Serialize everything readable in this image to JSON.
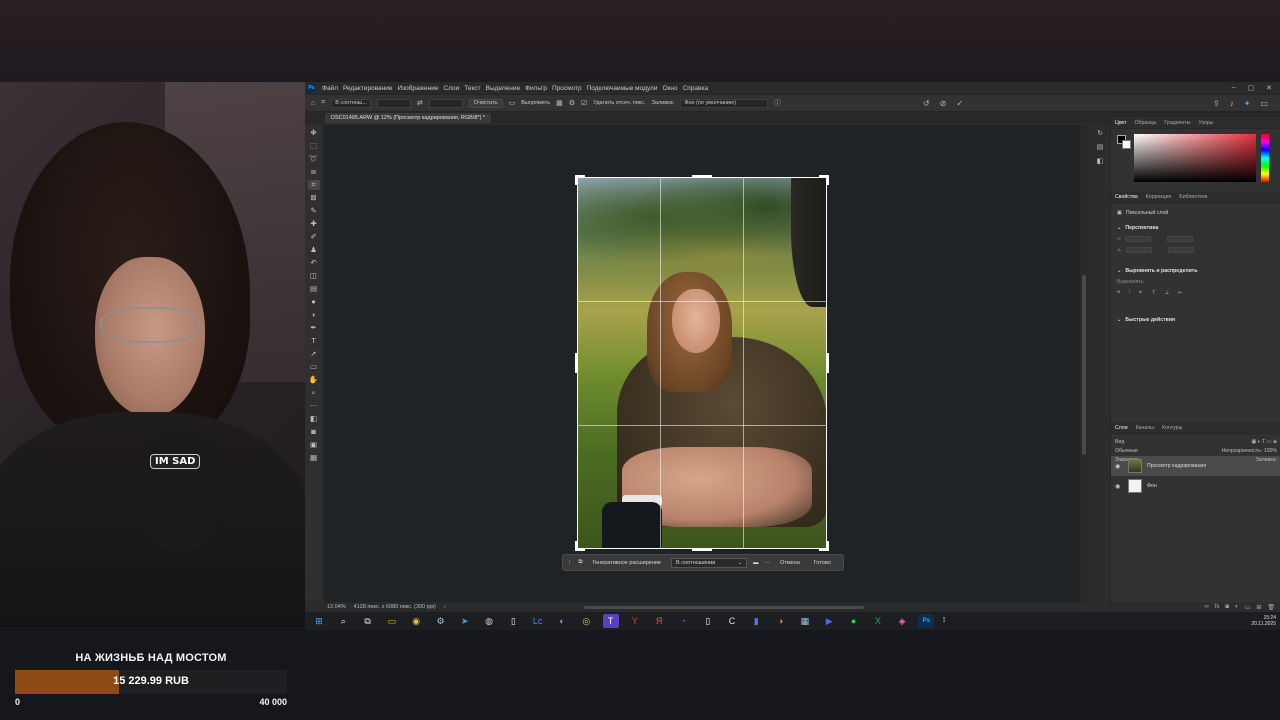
{
  "goal": {
    "title": "НА ЖИЗНЬБ НАД МОСТОМ",
    "amount": "15 229.99 RUB",
    "min": "0",
    "max": "40 000",
    "progress": 0.3807,
    "bar_color": "#8e4a14"
  },
  "webcam": {
    "mic_label": "IM SAD"
  },
  "photoshop": {
    "logo": "Ps",
    "menu": [
      "Файл",
      "Редактирование",
      "Изображение",
      "Слои",
      "Текст",
      "Выделение",
      "Фильтр",
      "Просмотр",
      "Подключаемые модули",
      "Окно",
      "Справка"
    ],
    "options": {
      "ratio": "В соотнош...",
      "clear": "Очистить",
      "straighten": "Выпрямить",
      "delete_pixels": "Удалить отсеч. пикс.",
      "fill_label": "Заливка:",
      "fill_value": "Фон (по умолчанию)"
    },
    "doc_tab": "DSC01495.ARW @ 12% (Просмотр кадрирования, RGB/8*) *",
    "crop_bar": {
      "generative": "Генеративное расширение",
      "ratio": "В соотношении",
      "cancel": "Отмена",
      "done": "Готово"
    },
    "status": {
      "zoom": "12.04%",
      "info": "4128 пикс. x 6080 пикс. (300 ppi)"
    },
    "panels": {
      "color_tabs": [
        "Цвет",
        "Образцы",
        "Градиенты",
        "Узоры"
      ],
      "props_tabs": [
        "Свойства",
        "Коррекция",
        "Библиотеки"
      ],
      "pixel_layer": "Пиксельный слой",
      "perspective": "Перспектива",
      "align": "Выровнять и распределить",
      "align_sub": "Выровнять",
      "quick_actions": "Быстрые действия",
      "layer_tabs": [
        "Слои",
        "Каналы",
        "Контуры"
      ],
      "search": "Вид",
      "blend": "Обычные",
      "opacity_label": "Непрозрачность:",
      "opacity_value": "100%",
      "lock_label": "Закрепить:",
      "fill_label": "Заливка:",
      "layers": [
        "Просмотр кадрирования",
        "Фон"
      ]
    }
  },
  "taskbar": {
    "time": "15:24",
    "date": "20.11.2025",
    "icons": [
      "windows-icon",
      "search-icon",
      "taskview-icon",
      "explorer-icon",
      "chrome-icon",
      "steam-icon",
      "telegram-icon",
      "obs-icon",
      "file-icon",
      "lsc-icon",
      "app-icon",
      "app2-icon",
      "text-icon",
      "yandex-icon",
      "yandex-browser-icon",
      "app3-icon",
      "doc-icon",
      "ccleaner-icon",
      "stats-icon",
      "firefox-icon",
      "calc-icon",
      "media-icon",
      "spotify-icon",
      "excel-icon",
      "app4-icon",
      "photoshop-icon"
    ],
    "icon_glyphs": [
      "⊞",
      "⌕",
      "⧉",
      "▭",
      "◉",
      "⚙",
      "➤",
      "◍",
      "▯",
      "Lc",
      "◐",
      "◎",
      "T",
      "Y",
      "Я",
      "◔",
      "▯",
      "C",
      "▮",
      "◑",
      "▦",
      "▶",
      "●",
      "X",
      "◈",
      "Ps"
    ],
    "icon_colors": [
      "#4aa3ff",
      "#e6e6e6",
      "#e6e6e6",
      "#e8b93a",
      "#e9c445",
      "#a8c7e6",
      "#38a4e0",
      "#d0d0d0",
      "#f0f0f0",
      "#4a8ae8",
      "#7aa0c0",
      "#c8d048",
      "#ffffff",
      "#e63a3a",
      "#ff4a4a",
      "#6a5acd",
      "#f0f0f0",
      "#e0e0e0",
      "#4a7ae8",
      "#ff8a2a",
      "#9ac7e6",
      "#4a6ae8",
      "#1ed760",
      "#21a366",
      "#ff6ac1",
      "#31a8ff"
    ]
  }
}
